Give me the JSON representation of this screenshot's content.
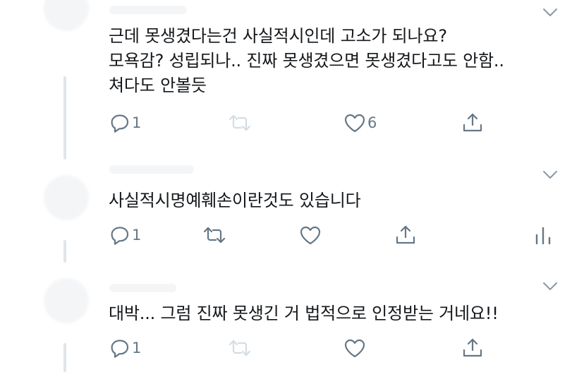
{
  "colors": {
    "text": "#14171a",
    "muted": "#657786",
    "disabled": "#d3dde4",
    "line": "#e1e5ea"
  },
  "tweets": [
    {
      "lines": [
        "근데 못생겼다는건 사실적시인데 고소가 되나요?",
        "모욕감? 성립되나.. 진짜 못생겼으면 못생겼다고도 안함..",
        "쳐다도 안볼듯"
      ],
      "reply_count": "1",
      "like_count": "6"
    },
    {
      "lines": [
        "사실적시명예훼손이란것도 있습니다"
      ],
      "reply_count": "1",
      "like_count": ""
    },
    {
      "lines": [
        "대박... 그럼 진짜 못생긴 거 법적으로 인정받는 거네요!!"
      ],
      "reply_count": "1",
      "like_count": ""
    }
  ],
  "icons": [
    "reply-icon",
    "retweet-icon",
    "like-icon",
    "share-icon",
    "analytics-icon",
    "chevron-down-icon"
  ]
}
